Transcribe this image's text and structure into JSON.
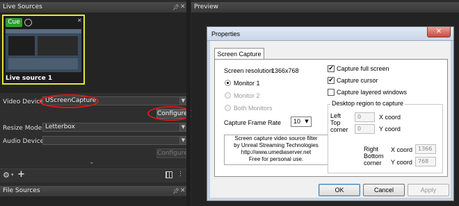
{
  "left_panel": {
    "tab_title": "Live Sources",
    "source": {
      "cue_label": "Cue",
      "name": "Live source 1"
    },
    "video_device": {
      "label": "Video Device",
      "value": "UScreenCapture",
      "configure_label": "Configure"
    },
    "resize_mode": {
      "label": "Resize Mode",
      "value": "Letterbox"
    },
    "audio_device": {
      "label": "Audio Device",
      "value": "",
      "configure_label": "Configure"
    },
    "file_sources_tab": "File Sources"
  },
  "preview": {
    "tab_title": "Preview"
  },
  "dialog": {
    "title": "Properties",
    "tab": "Screen Capture",
    "resolution_label": "Screen resolution:",
    "resolution_value": "1366x768",
    "monitor_options": [
      {
        "label": "Monitor 1",
        "selected": true,
        "enabled": true
      },
      {
        "label": "Monitor 2",
        "selected": false,
        "enabled": false
      },
      {
        "label": "Both Monitors",
        "selected": false,
        "enabled": false
      }
    ],
    "frame_rate_label": "Capture Frame Rate",
    "frame_rate_value": "10",
    "checkboxes": [
      {
        "label": "Capture full screen",
        "checked": true
      },
      {
        "label": "Capture cursor",
        "checked": true
      },
      {
        "label": "Capture layered windows",
        "checked": false
      }
    ],
    "region_group_label": "Desktop region to capture",
    "left_top_label_1": "Left",
    "left_top_label_2": "Top",
    "left_top_label_3": "corner",
    "left_x": "0",
    "left_y": "0",
    "x_coord_label": "X coord",
    "y_coord_label": "Y coord",
    "right_bottom_label_1": "Right",
    "right_bottom_label_2": "Bottom",
    "right_bottom_label_3": "corner",
    "right_x": "1366",
    "right_y": "768",
    "info_lines": [
      "Screen capture video source filter",
      "by Unreal Streaming Technologies",
      "http://www.umediaserver.net",
      "Free for personal use."
    ],
    "ok_label": "OK",
    "cancel_label": "Cancel",
    "apply_label": "Apply"
  },
  "colors": {
    "cue_green": "#2f9e2f",
    "highlight_yellow": "#e6e63a",
    "annotation_red": "#e01616"
  }
}
